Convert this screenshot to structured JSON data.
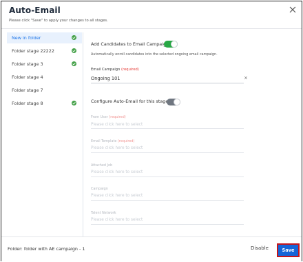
{
  "modal": {
    "title": "Auto-Email",
    "subtitle": "Please click \"Save\" to apply your changes to all stages.",
    "close_icon": "close-icon"
  },
  "sidebar": {
    "items": [
      {
        "label": "New in folder",
        "active": true,
        "checked": true
      },
      {
        "label": "Folder stage 22222",
        "active": false,
        "checked": true
      },
      {
        "label": "Folder stage 3",
        "active": false,
        "checked": true
      },
      {
        "label": "Folder stage 4",
        "active": false,
        "checked": false
      },
      {
        "label": "Folder stage 7",
        "active": false,
        "checked": false
      },
      {
        "label": "Folder stage 8",
        "active": false,
        "checked": true
      }
    ]
  },
  "add_candidates": {
    "label": "Add Candidates to Email Campaign",
    "enabled": true,
    "description": "Automatically enroll candidates into the selected ongoing email campaign."
  },
  "email_campaign": {
    "label": "Email Campaign",
    "required": "(required)",
    "value": "Ongoing 101",
    "clear": "×"
  },
  "configure": {
    "label": "Configure Auto-Email for this stage",
    "enabled": false
  },
  "fields": [
    {
      "label": "From User",
      "required": "(required)",
      "placeholder": "Please click here to select"
    },
    {
      "label": "Email Template",
      "required": "(required)",
      "placeholder": "Please click here to select"
    },
    {
      "label": "Attached Job",
      "required": "",
      "placeholder": "Please click here to select"
    },
    {
      "label": "Campaign",
      "required": "",
      "placeholder": "Please click here to select"
    },
    {
      "label": "Talent Network",
      "required": "",
      "placeholder": "Please click here to select"
    }
  ],
  "footer": {
    "folder_text": "Folder: folder with AE campaign - 1",
    "disable_label": "Disable",
    "save_label": "Save"
  },
  "colors": {
    "accent": "#1565d8",
    "success": "#43a047",
    "required": "#e53935",
    "highlight": "#c4161c"
  }
}
